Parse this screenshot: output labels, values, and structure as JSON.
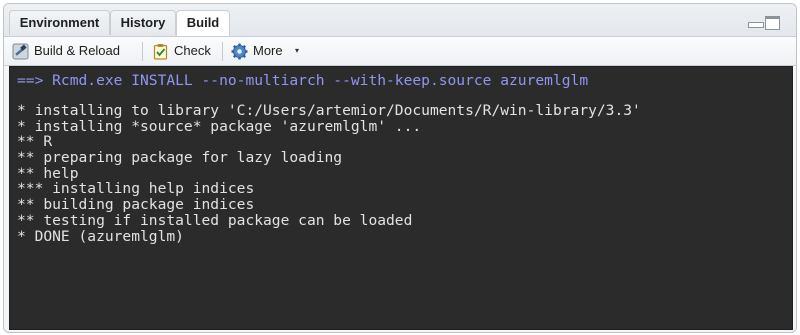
{
  "tabs": [
    {
      "label": "Environment",
      "active": false
    },
    {
      "label": "History",
      "active": false
    },
    {
      "label": "Build",
      "active": true
    }
  ],
  "toolbar": {
    "build_reload_label": "Build & Reload",
    "check_label": "Check",
    "more_label": "More",
    "more_caret": "▾"
  },
  "console": {
    "command": "==> Rcmd.exe INSTALL --no-multiarch --with-keep.source azuremlglm",
    "lines": [
      "* installing to library 'C:/Users/artemior/Documents/R/win-library/3.3'",
      "* installing *source* package 'azuremlglm' ...",
      "** R",
      "** preparing package for lazy loading",
      "** help",
      "*** installing help indices",
      "** building package indices",
      "** testing if installed package can be loaded",
      "* DONE (azuremlglm)"
    ]
  },
  "colors": {
    "console_bg": "#2b2b2b",
    "command_text": "#8f96f2",
    "output_text": "#e2e2e2"
  },
  "icons": [
    "build-hammer-icon",
    "check-clipboard-icon",
    "gear-icon",
    "minimize-icon",
    "maximize-icon"
  ]
}
